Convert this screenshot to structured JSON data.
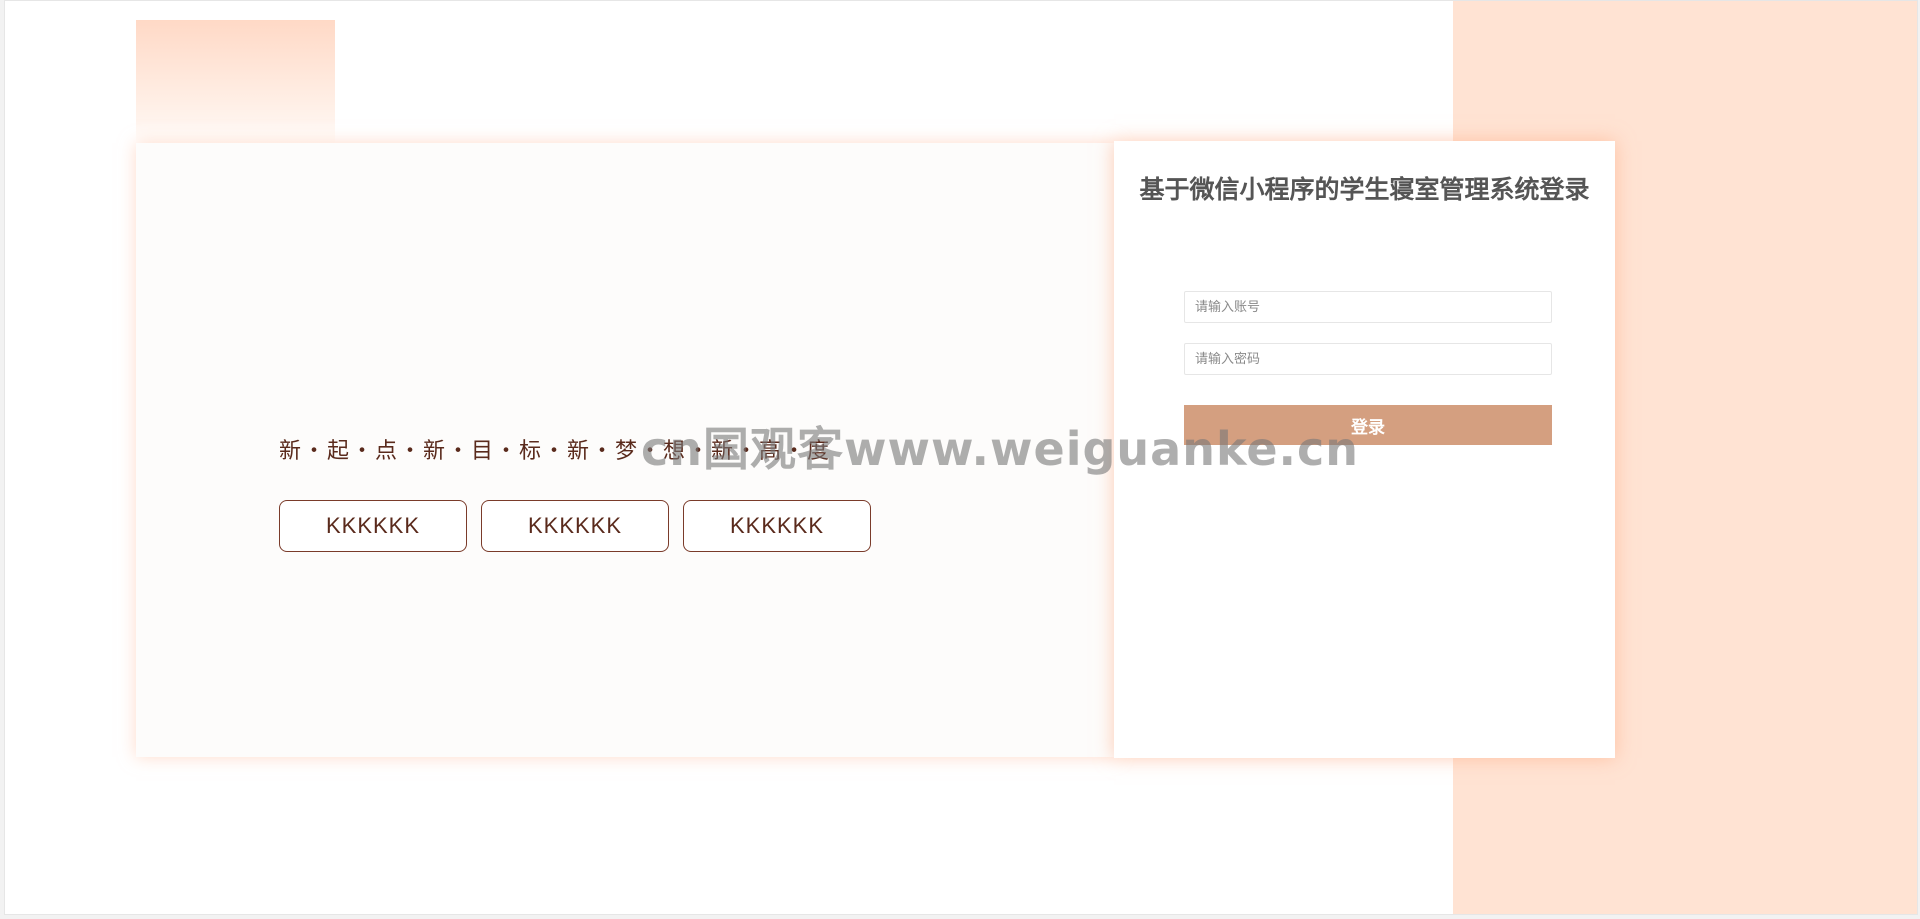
{
  "left_panel": {
    "slogan": "新・起・点・新・目・标・新・梦・想・新・高・度",
    "tags": [
      "KKKKKK",
      "KKKKKK",
      "KKKKKK"
    ]
  },
  "login": {
    "title": "基于微信小程序的学生寝室管理系统登录",
    "account_placeholder": "请输入账号",
    "password_placeholder": "请输入密码",
    "submit_label": "登录"
  },
  "watermark": {
    "text": "cn国观客www.weiguanke.cn"
  },
  "colors": {
    "accent": "#d49f80",
    "band": "#ffe3d3",
    "text_dark": "#5a2a1c"
  }
}
